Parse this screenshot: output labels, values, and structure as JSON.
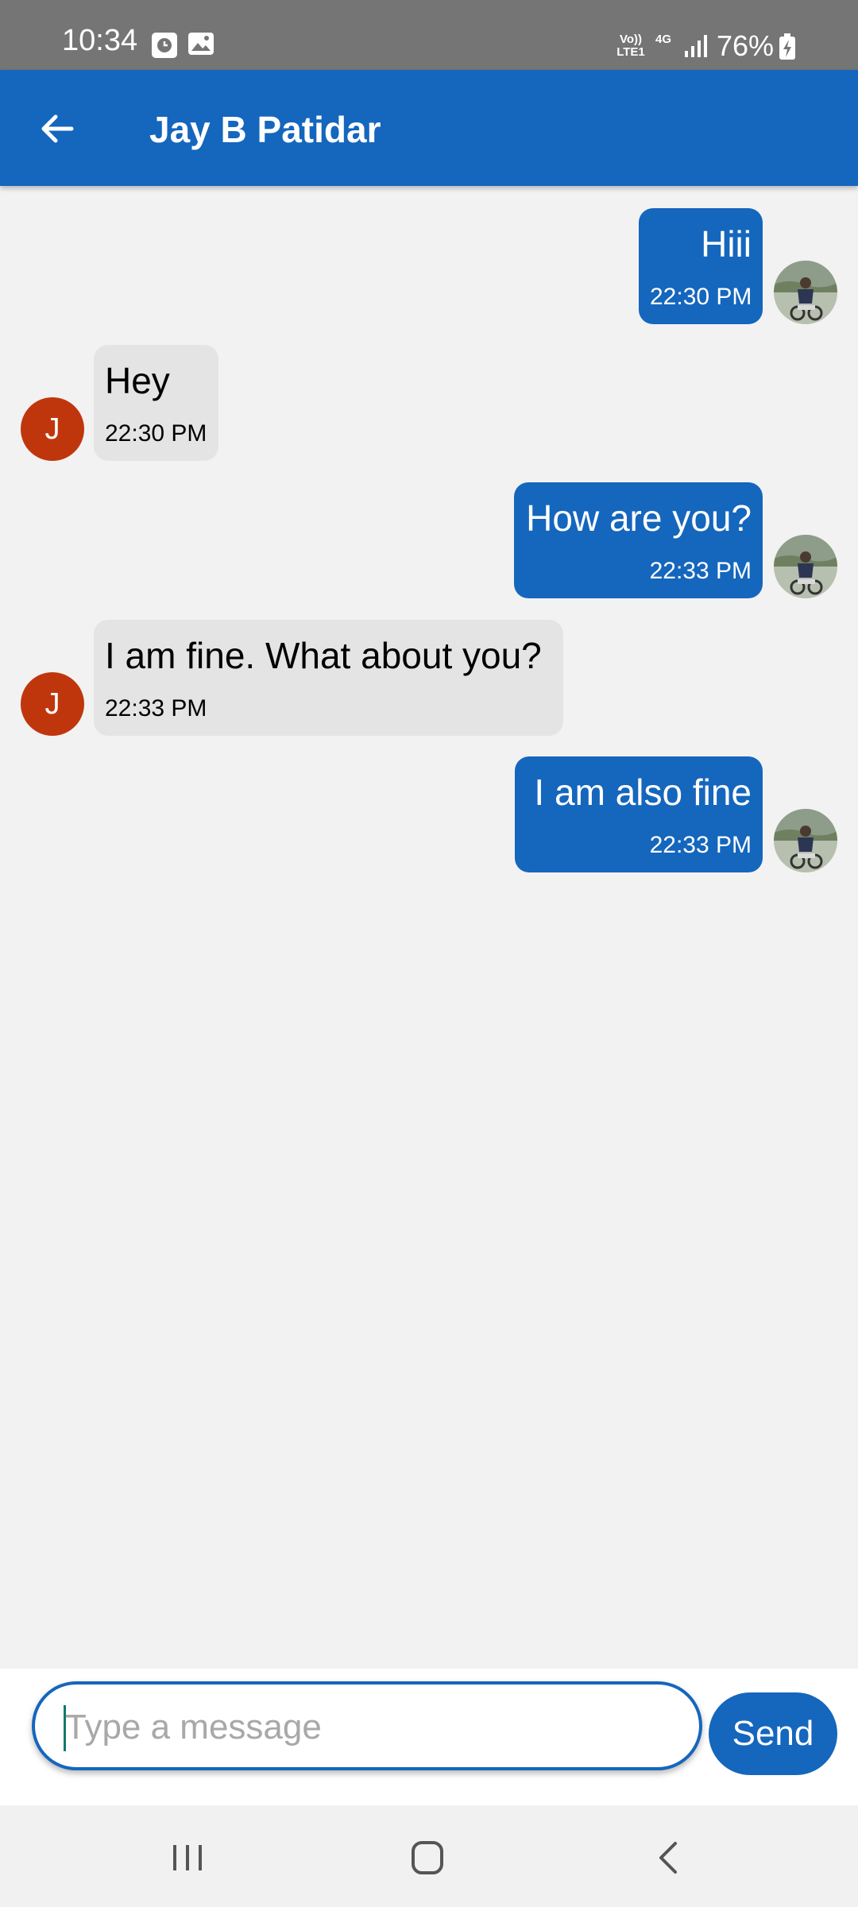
{
  "status_bar": {
    "time": "10:34",
    "volte_label": "Vo))",
    "lte_label": "LTE1",
    "network_label": "4G",
    "battery_percent": "76%",
    "icons": [
      "alarm-icon",
      "gallery-icon",
      "signal-icon",
      "battery-charging-icon"
    ]
  },
  "header": {
    "title": "Jay B Patidar",
    "back_icon": "arrow-left-icon",
    "color": "#1566bd"
  },
  "messages": [
    {
      "direction": "outgoing",
      "text": "Hiii",
      "time": "22:30 PM",
      "avatar": "user-photo"
    },
    {
      "direction": "incoming",
      "text": "Hey",
      "time": "22:30 PM",
      "avatar_letter": "J"
    },
    {
      "direction": "outgoing",
      "text": "How are you?",
      "time": "22:33 PM",
      "avatar": "user-photo"
    },
    {
      "direction": "incoming",
      "text": "I am fine. What about you?",
      "time": "22:33 PM",
      "avatar_letter": "J"
    },
    {
      "direction": "outgoing",
      "text": "I am also fine",
      "time": "22:33 PM",
      "avatar": "user-photo"
    }
  ],
  "composer": {
    "placeholder": "Type a message",
    "value": "",
    "send_label": "Send"
  },
  "colors": {
    "accent": "#1566bd",
    "incoming_bubble": "#e4e4e4",
    "avatar_letter_bg": "#c0360c",
    "background": "#f2f2f2"
  },
  "nav_bar": {
    "icons": [
      "recent-apps-icon",
      "home-icon",
      "back-icon"
    ]
  }
}
